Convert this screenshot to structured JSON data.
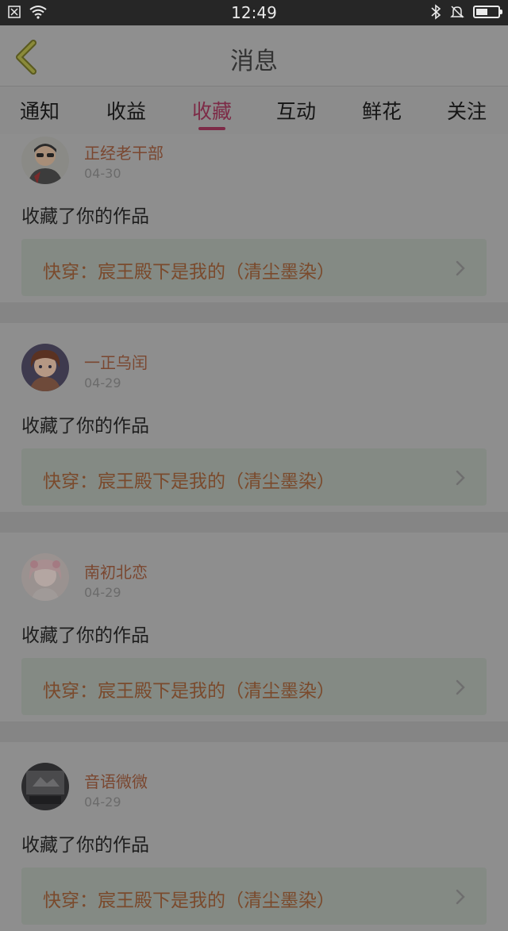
{
  "status_bar": {
    "time": "12:49",
    "battery_level": 0.55,
    "left_icons": [
      "notification-icon",
      "wifi-icon"
    ],
    "right_icons": [
      "bluetooth-icon",
      "silent-icon",
      "battery-icon"
    ]
  },
  "header": {
    "title": "消息"
  },
  "tabs": [
    {
      "label": "通知",
      "active": false
    },
    {
      "label": "收益",
      "active": false
    },
    {
      "label": "收藏",
      "active": true
    },
    {
      "label": "互动",
      "active": false
    },
    {
      "label": "鲜花",
      "active": false
    },
    {
      "label": "关注",
      "active": false
    }
  ],
  "feed": [
    {
      "username": "正经老干部",
      "date": "04-30",
      "action": "收藏了你的作品",
      "work_title": "快穿：宸王殿下是我的（清尘墨染）"
    },
    {
      "username": "一正乌闰",
      "date": "04-29",
      "action": "收藏了你的作品",
      "work_title": "快穿：宸王殿下是我的（清尘墨染）"
    },
    {
      "username": "南初北恋",
      "date": "04-29",
      "action": "收藏了你的作品",
      "work_title": "快穿：宸王殿下是我的（清尘墨染）"
    },
    {
      "username": "音语微微",
      "date": "04-29",
      "action": "收藏了你的作品",
      "work_title": "快穿：宸王殿下是我的（清尘墨染）"
    }
  ],
  "colors": {
    "accent": "#7d2b47",
    "username": "#7a4730",
    "overlay_bg": "#8c8c8c"
  }
}
